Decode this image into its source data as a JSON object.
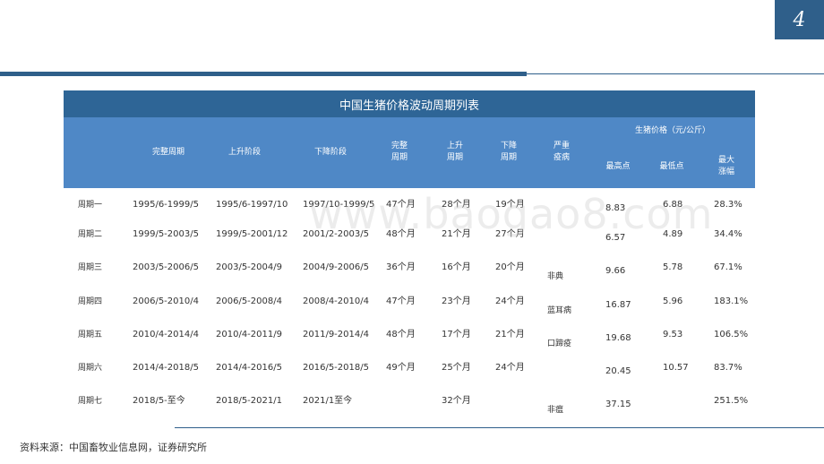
{
  "page": {
    "number": "4"
  },
  "table": {
    "title": "中国生猪价格波动周期列表",
    "headers": {
      "full_cycle": "完整周期",
      "rising_stage": "上升阶段",
      "falling_stage": "下降阶段",
      "full_cycle_length": "完整\n周期",
      "rising_length": "上升\n周期",
      "falling_length": "下降\n周期",
      "epidemic": "严重\n疫病",
      "price_group": "生猪价格（元/公斤）",
      "price_high": "最高点",
      "price_low": "最低点",
      "max_increase": "最大\n涨幅"
    },
    "rows": [
      {
        "label": "周期一",
        "full": "1995/6-1999/5",
        "rise": "1995/6-1997/10",
        "fall": "1997/10-1999/5",
        "full_len": "47个月",
        "rise_len": "28个月",
        "fall_len": "19个月",
        "epidemic": "",
        "high": "8.83",
        "low": "6.88",
        "increase": "28.3%"
      },
      {
        "label": "周期二",
        "full": "1999/5-2003/5",
        "rise": "1999/5-2001/12",
        "fall": "2001/2-2003/5",
        "full_len": "48个月",
        "rise_len": "21个月",
        "fall_len": "27个月",
        "epidemic": "",
        "high": "6.57",
        "low": "4.89",
        "increase": "34.4%"
      },
      {
        "label": "周期三",
        "full": "2003/5-2006/5",
        "rise": "2003/5-2004/9",
        "fall": "2004/9-2006/5",
        "full_len": "36个月",
        "rise_len": "16个月",
        "fall_len": "20个月",
        "epidemic": "非典",
        "high": "9.66",
        "low": "5.78",
        "increase": "67.1%"
      },
      {
        "label": "周期四",
        "full": "2006/5-2010/4",
        "rise": "2006/5-2008/4",
        "fall": "2008/4-2010/4",
        "full_len": "47个月",
        "rise_len": "23个月",
        "fall_len": "24个月",
        "epidemic": "蓝耳病",
        "high": "16.87",
        "low": "5.96",
        "increase": "183.1%"
      },
      {
        "label": "周期五",
        "full": "2010/4-2014/4",
        "rise": "2010/4-2011/9",
        "fall": "2011/9-2014/4",
        "full_len": "48个月",
        "rise_len": "17个月",
        "fall_len": "21个月",
        "epidemic": "口蹄疫",
        "high": "19.68",
        "low": "9.53",
        "increase": "106.5%"
      },
      {
        "label": "周期六",
        "full": "2014/4-2018/5",
        "rise": "2014/4-2016/5",
        "fall": "2016/5-2018/5",
        "full_len": "49个月",
        "rise_len": "25个月",
        "fall_len": "24个月",
        "epidemic": "",
        "high": "20.45",
        "low": "10.57",
        "increase": "83.7%"
      },
      {
        "label": "周期七",
        "full": "2018/5-至今",
        "rise": "2018/5-2021/1",
        "fall": "2021/1至今",
        "full_len": "",
        "rise_len": "32个月",
        "fall_len": "",
        "epidemic": "非瘟",
        "high": "37.15",
        "low": "",
        "increase": "251.5%"
      }
    ]
  },
  "source_note": "资料来源：中国畜牧业信息网，证券研究所",
  "watermark": "www.baogao8.com"
}
